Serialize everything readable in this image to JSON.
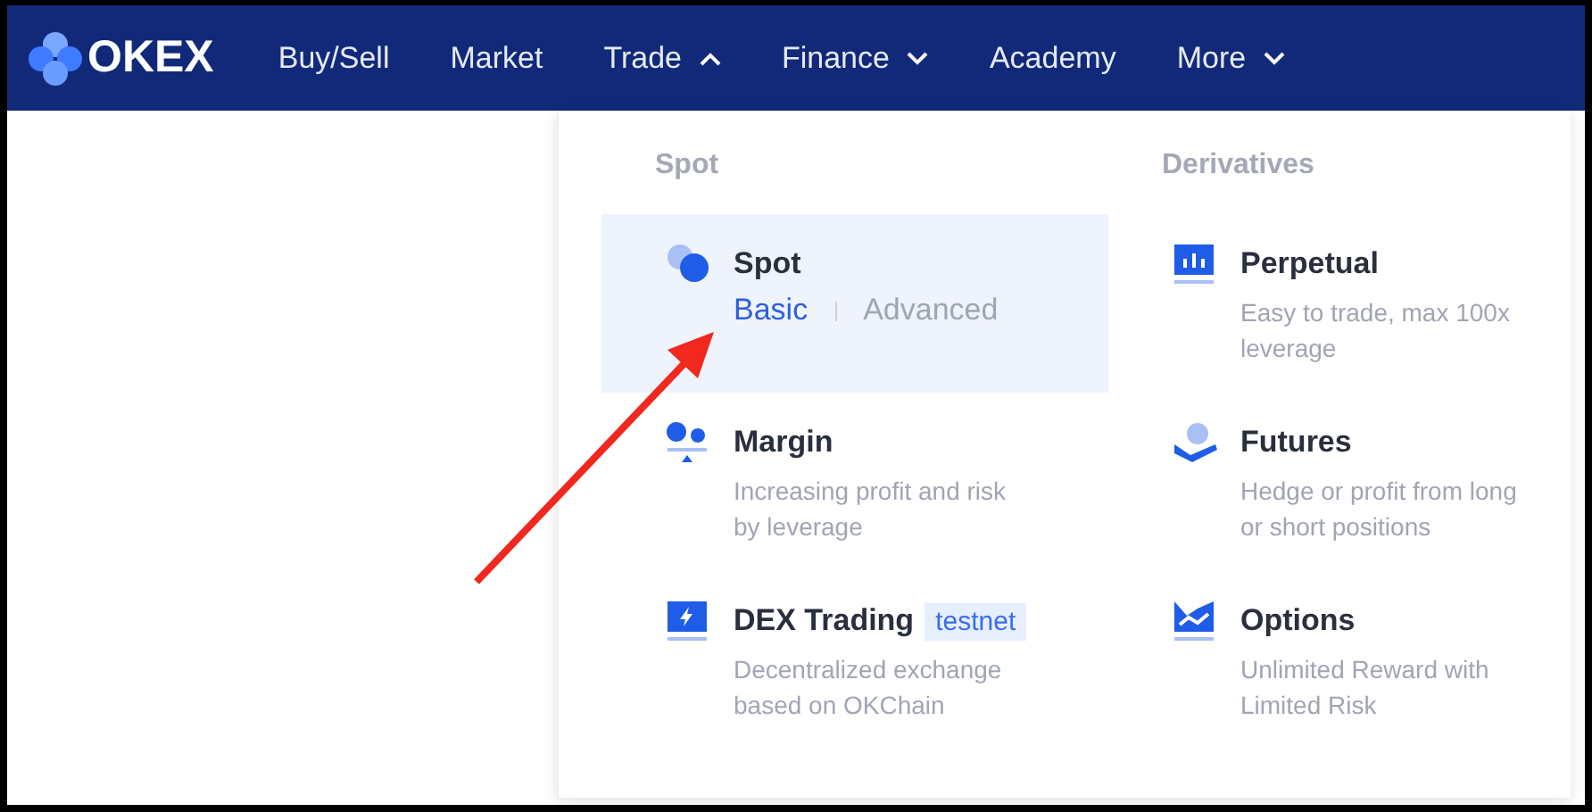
{
  "logo": {
    "text": "OKEX"
  },
  "nav": [
    {
      "label": "Buy/Sell",
      "dropdown": false
    },
    {
      "label": "Market",
      "dropdown": false
    },
    {
      "label": "Trade",
      "dropdown": true,
      "expanded": true
    },
    {
      "label": "Finance",
      "dropdown": true,
      "expanded": false
    },
    {
      "label": "Academy",
      "dropdown": false
    },
    {
      "label": "More",
      "dropdown": true,
      "expanded": false
    }
  ],
  "menu": {
    "sections": [
      {
        "heading": "Spot",
        "items": [
          {
            "title": "Spot",
            "highlighted": true,
            "links": [
              {
                "label": "Basic",
                "selected": true
              },
              {
                "label": "Advanced",
                "selected": false
              }
            ]
          },
          {
            "title": "Margin",
            "highlighted": false,
            "description": "Increasing profit and risk by leverage"
          },
          {
            "title": "DEX Trading",
            "highlighted": false,
            "badge": "testnet",
            "description": "Decentralized exchange based on OKChain"
          }
        ]
      },
      {
        "heading": "Derivatives",
        "items": [
          {
            "title": "Perpetual",
            "highlighted": false,
            "description": "Easy to trade, max 100x leverage"
          },
          {
            "title": "Futures",
            "highlighted": false,
            "description": "Hedge or profit from long or short positions"
          },
          {
            "title": "Options",
            "highlighted": false,
            "description": "Unlimited Reward with Limited Risk"
          }
        ]
      }
    ]
  }
}
